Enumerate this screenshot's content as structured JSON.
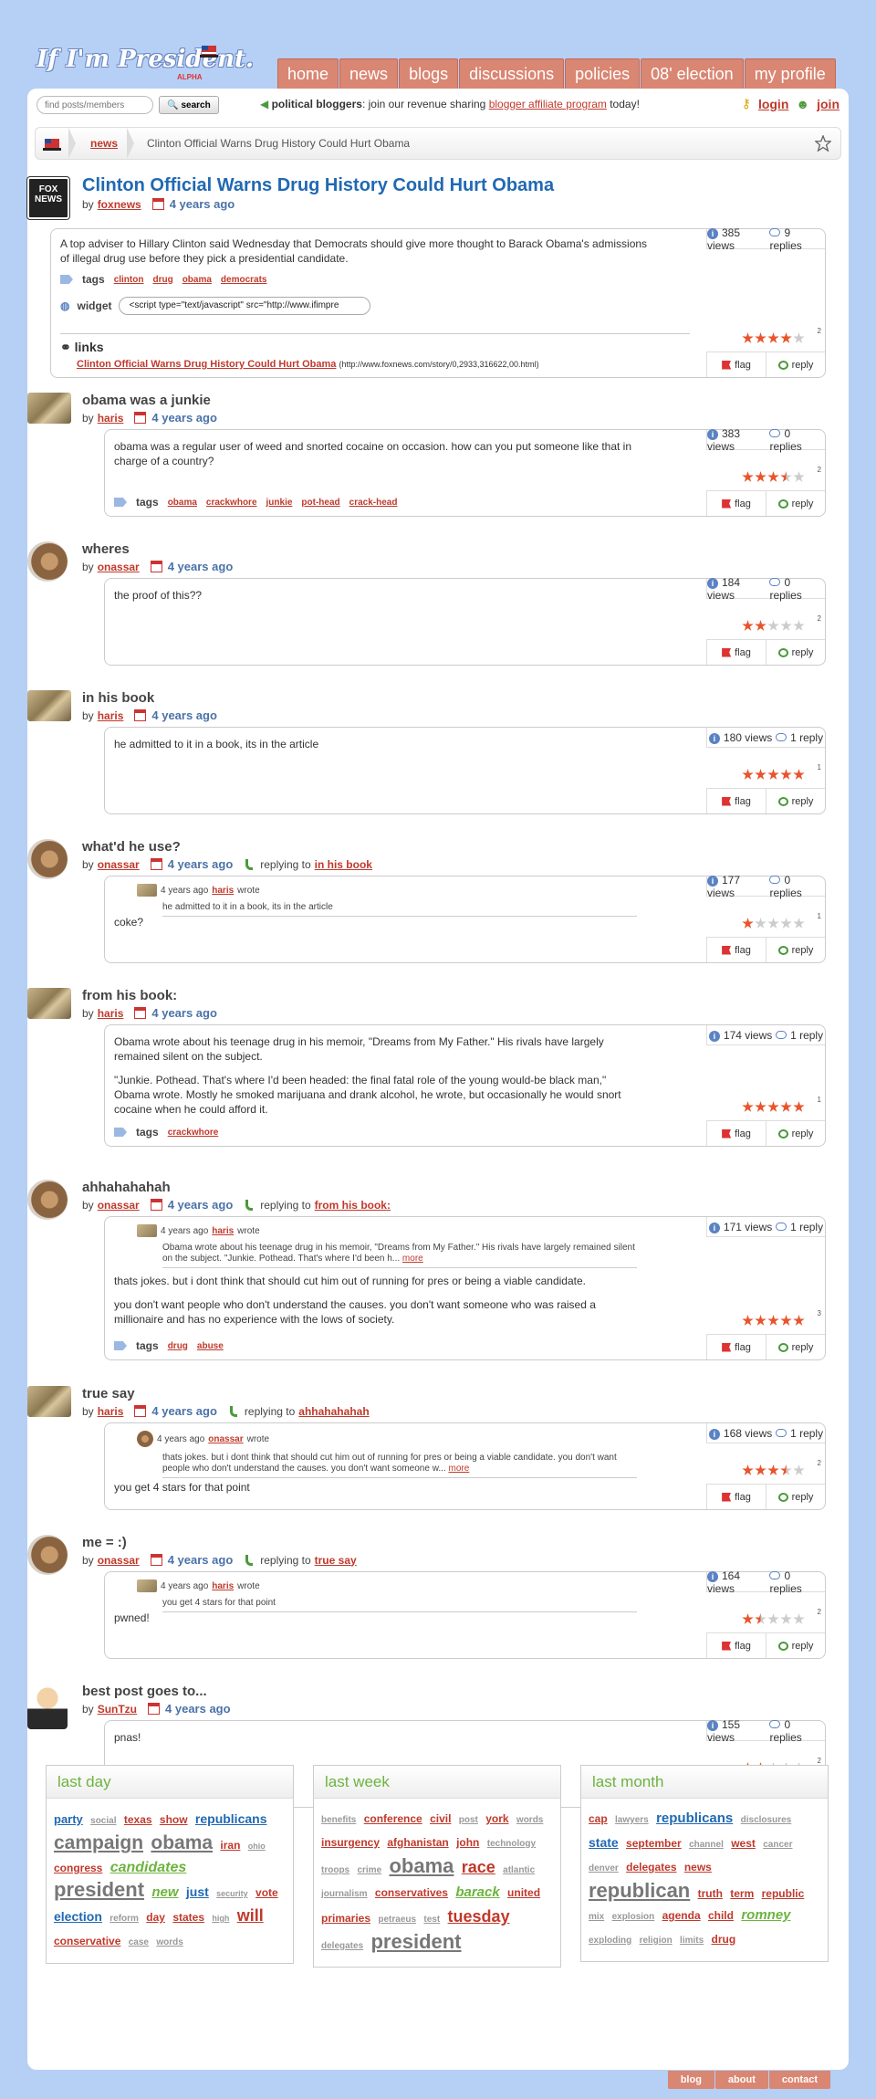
{
  "header": {
    "logo": "If I'm President.",
    "logo_badge": "ALPHA",
    "nav": [
      "home",
      "news",
      "blogs",
      "discussions",
      "policies",
      "08' election",
      "my profile"
    ]
  },
  "toolbar": {
    "search_placeholder": "find posts/members",
    "search_label": "search",
    "promo_bold": "political bloggers",
    "promo_text": ": join our revenue sharing ",
    "promo_link": "blogger affiliate program",
    "promo_tail": " today!",
    "login": "login",
    "join": "join"
  },
  "breadcrumb": {
    "section": "news",
    "title": "Clinton Official Warns Drug History Could Hurt Obama"
  },
  "article": {
    "avatar_text": "FOX NEWS",
    "title": "Clinton Official Warns Drug History Could Hurt Obama",
    "by": "by",
    "author": "foxnews",
    "ago": "4 years ago",
    "body": "A top adviser to Hillary Clinton said Wednesday that Democrats should give more thought to Barack Obama's admissions of illegal drug use before they pick a presidential candidate.",
    "tags_label": "tags",
    "tags": [
      "clinton",
      "drug",
      "obama",
      "democrats"
    ],
    "widget_label": "widget",
    "widget_code": "<script type=\"text/javascript\" src=\"http://www.ifimpre",
    "links_label": "links",
    "link_text": "Clinton Official Warns Drug History Could Hurt Obama",
    "link_url": "(http://www.foxnews.com/story/0,2933,316622,00.html)",
    "views": "385 views",
    "replies": "9 replies",
    "rating": 4,
    "votes": "2"
  },
  "labels": {
    "flag": "flag",
    "reply": "reply",
    "replying_to": "replying to",
    "wrote": "wrote",
    "tags": "tags",
    "more": "more"
  },
  "posts": [
    {
      "title": "obama was a junkie",
      "author": "haris",
      "ago": "4 years ago",
      "body": [
        "obama was a regular user of weed and snorted cocaine on occasion. how can you put someone like that in charge of a country?"
      ],
      "tags": [
        "obama",
        "crackwhore",
        "junkie",
        "pot-head",
        "crack-head"
      ],
      "views": "383 views",
      "replies": "0 replies",
      "rating": 3.5,
      "votes": "2"
    },
    {
      "title": "wheres",
      "author": "onassar",
      "ago": "4 years ago",
      "body": [
        "the proof of this??"
      ],
      "views": "184 views",
      "replies": "0 replies",
      "rating": 2,
      "votes": "2"
    },
    {
      "title": "in his book",
      "author": "haris",
      "ago": "4 years ago",
      "body": [
        "he admitted to it in a book, its in the article"
      ],
      "views": "180 views",
      "replies": "1 reply",
      "rating": 5,
      "votes": "1"
    },
    {
      "title": "what'd he use?",
      "author": "onassar",
      "ago": "4 years ago",
      "reply_to": "in his book",
      "quote_ago": "4 years ago",
      "quote_author": "haris",
      "quote_text": "he admitted to it in a book, its in the article",
      "body": [
        "coke?"
      ],
      "views": "177 views",
      "replies": "0 replies",
      "rating": 1,
      "votes": "1"
    },
    {
      "title": "from his book:",
      "author": "haris",
      "ago": "4 years ago",
      "body": [
        "Obama wrote about his teenage drug in his memoir, \"Dreams from My Father.\" His rivals have largely remained silent on the subject.",
        "\"Junkie. Pothead. That's where I'd been headed: the final fatal role of the young would-be black man,\" Obama wrote. Mostly he smoked marijuana and drank alcohol, he wrote, but occasionally he would snort cocaine when he could afford it."
      ],
      "tags": [
        "crackwhore"
      ],
      "views": "174 views",
      "replies": "1 reply",
      "rating": 5,
      "votes": "1"
    },
    {
      "title": "ahhahahahah",
      "author": "onassar",
      "ago": "4 years ago",
      "reply_to": "from his book:",
      "quote_ago": "4 years ago",
      "quote_author": "haris",
      "quote_text": "Obama wrote about his teenage drug in his memoir, \"Dreams from My Father.\" His rivals have largely remained silent on the subject. \"Junkie. Pothead. That's where I'd been h...",
      "body": [
        "thats jokes. but i dont think that should cut him out of running for pres or being a viable candidate.",
        "you don't want people who don't understand the causes. you don't want someone who was raised a millionaire and has no experience with the lows of society."
      ],
      "tags": [
        "drug",
        "abuse"
      ],
      "views": "171 views",
      "replies": "1 reply",
      "rating": 5,
      "votes": "3"
    },
    {
      "title": "true say",
      "author": "haris",
      "ago": "4 years ago",
      "reply_to": "ahhahahahah",
      "quote_ago": "4 years ago",
      "quote_author": "onassar",
      "quote_text": "thats jokes. but i dont think that should cut him out of running for pres or being a viable candidate. you don't want people who don't understand the causes. you don't want someone w...",
      "body": [
        "you get 4 stars for that point"
      ],
      "views": "168 views",
      "replies": "1 reply",
      "rating": 3.5,
      "votes": "2"
    },
    {
      "title": "me = :)",
      "author": "onassar",
      "ago": "4 years ago",
      "reply_to": "true say",
      "quote_ago": "4 years ago",
      "quote_author": "haris",
      "quote_text": "you get 4 stars for that point",
      "body": [
        "pwned!"
      ],
      "views": "164 views",
      "replies": "0 replies",
      "rating": 1.5,
      "votes": "2"
    },
    {
      "title": "best post goes to...",
      "author": "SunTzu",
      "ago": "4 years ago",
      "body": [
        "pnas!"
      ],
      "views": "155 views",
      "replies": "0 replies",
      "rating": 2,
      "votes": "2"
    }
  ],
  "clouds": [
    {
      "title": "last day",
      "words": [
        {
          "w": "party",
          "s": 13,
          "c": "#2069b3"
        },
        {
          "w": "social",
          "s": 10,
          "c": "#999"
        },
        {
          "w": "texas",
          "s": 12,
          "c": "#c0392b"
        },
        {
          "w": "show",
          "s": 12,
          "c": "#c0392b"
        },
        {
          "w": "republicans",
          "s": 14,
          "c": "#2069b3"
        },
        {
          "w": "campaign",
          "s": 21,
          "c": "#777"
        },
        {
          "w": "obama",
          "s": 21,
          "c": "#777"
        },
        {
          "w": "iran",
          "s": 12,
          "c": "#c0392b"
        },
        {
          "w": "ohio",
          "s": 9,
          "c": "#999"
        },
        {
          "w": "congress",
          "s": 12,
          "c": "#c0392b"
        },
        {
          "w": "candidates",
          "s": 16,
          "c": "#6db33f",
          "i": true
        },
        {
          "w": "president",
          "s": 22,
          "c": "#777"
        },
        {
          "w": "new",
          "s": 15,
          "c": "#6db33f",
          "i": true
        },
        {
          "w": "just",
          "s": 14,
          "c": "#2069b3"
        },
        {
          "w": "security",
          "s": 9,
          "c": "#999"
        },
        {
          "w": "vote",
          "s": 12,
          "c": "#c0392b"
        },
        {
          "w": "election",
          "s": 14,
          "c": "#2069b3"
        },
        {
          "w": "reform",
          "s": 10,
          "c": "#999"
        },
        {
          "w": "day",
          "s": 12,
          "c": "#c0392b"
        },
        {
          "w": "states",
          "s": 12,
          "c": "#c0392b"
        },
        {
          "w": "high",
          "s": 9,
          "c": "#999"
        },
        {
          "w": "will",
          "s": 18,
          "c": "#c0392b"
        },
        {
          "w": "conservative",
          "s": 12,
          "c": "#c0392b"
        },
        {
          "w": "case",
          "s": 10,
          "c": "#999"
        },
        {
          "w": "words",
          "s": 10,
          "c": "#999"
        }
      ]
    },
    {
      "title": "last week",
      "words": [
        {
          "w": "benefits",
          "s": 10,
          "c": "#999"
        },
        {
          "w": "conference",
          "s": 12,
          "c": "#c0392b"
        },
        {
          "w": "civil",
          "s": 12,
          "c": "#c0392b"
        },
        {
          "w": "post",
          "s": 10,
          "c": "#999"
        },
        {
          "w": "york",
          "s": 12,
          "c": "#c0392b"
        },
        {
          "w": "words",
          "s": 10,
          "c": "#999"
        },
        {
          "w": "insurgency",
          "s": 12,
          "c": "#c0392b"
        },
        {
          "w": "afghanistan",
          "s": 12,
          "c": "#c0392b"
        },
        {
          "w": "john",
          "s": 12,
          "c": "#c0392b"
        },
        {
          "w": "technology",
          "s": 10,
          "c": "#999"
        },
        {
          "w": "troops",
          "s": 10,
          "c": "#999"
        },
        {
          "w": "crime",
          "s": 10,
          "c": "#999"
        },
        {
          "w": "obama",
          "s": 22,
          "c": "#777"
        },
        {
          "w": "race",
          "s": 18,
          "c": "#c0392b"
        },
        {
          "w": "atlantic",
          "s": 10,
          "c": "#999"
        },
        {
          "w": "journalism",
          "s": 10,
          "c": "#999"
        },
        {
          "w": "conservatives",
          "s": 12,
          "c": "#c0392b"
        },
        {
          "w": "barack",
          "s": 15,
          "c": "#6db33f",
          "i": true
        },
        {
          "w": "united",
          "s": 12,
          "c": "#c0392b"
        },
        {
          "w": "primaries",
          "s": 12,
          "c": "#c0392b"
        },
        {
          "w": "petraeus",
          "s": 10,
          "c": "#999"
        },
        {
          "w": "test",
          "s": 10,
          "c": "#999"
        },
        {
          "w": "tuesday",
          "s": 18,
          "c": "#c0392b"
        },
        {
          "w": "delegates",
          "s": 10,
          "c": "#999"
        },
        {
          "w": "president",
          "s": 22,
          "c": "#777"
        }
      ]
    },
    {
      "title": "last month",
      "words": [
        {
          "w": "cap",
          "s": 12,
          "c": "#c0392b"
        },
        {
          "w": "lawyers",
          "s": 10,
          "c": "#999"
        },
        {
          "w": "republicans",
          "s": 15,
          "c": "#2069b3"
        },
        {
          "w": "disclosures",
          "s": 10,
          "c": "#999"
        },
        {
          "w": "state",
          "s": 14,
          "c": "#2069b3"
        },
        {
          "w": "september",
          "s": 12,
          "c": "#c0392b"
        },
        {
          "w": "channel",
          "s": 10,
          "c": "#999"
        },
        {
          "w": "west",
          "s": 12,
          "c": "#c0392b"
        },
        {
          "w": "cancer",
          "s": 10,
          "c": "#999"
        },
        {
          "w": "denver",
          "s": 10,
          "c": "#999"
        },
        {
          "w": "delegates",
          "s": 12,
          "c": "#c0392b"
        },
        {
          "w": "news",
          "s": 12,
          "c": "#c0392b"
        },
        {
          "w": "republican",
          "s": 22,
          "c": "#777"
        },
        {
          "w": "truth",
          "s": 12,
          "c": "#c0392b"
        },
        {
          "w": "term",
          "s": 12,
          "c": "#c0392b"
        },
        {
          "w": "republic",
          "s": 12,
          "c": "#c0392b"
        },
        {
          "w": "mix",
          "s": 10,
          "c": "#999"
        },
        {
          "w": "explosion",
          "s": 10,
          "c": "#999"
        },
        {
          "w": "agenda",
          "s": 12,
          "c": "#c0392b"
        },
        {
          "w": "child",
          "s": 12,
          "c": "#c0392b"
        },
        {
          "w": "romney",
          "s": 15,
          "c": "#6db33f",
          "i": true
        },
        {
          "w": "exploding",
          "s": 10,
          "c": "#999"
        },
        {
          "w": "religion",
          "s": 10,
          "c": "#999"
        },
        {
          "w": "limits",
          "s": 10,
          "c": "#999"
        },
        {
          "w": "drug",
          "s": 12,
          "c": "#c0392b"
        }
      ]
    }
  ],
  "footer": [
    "blog",
    "about",
    "contact"
  ]
}
